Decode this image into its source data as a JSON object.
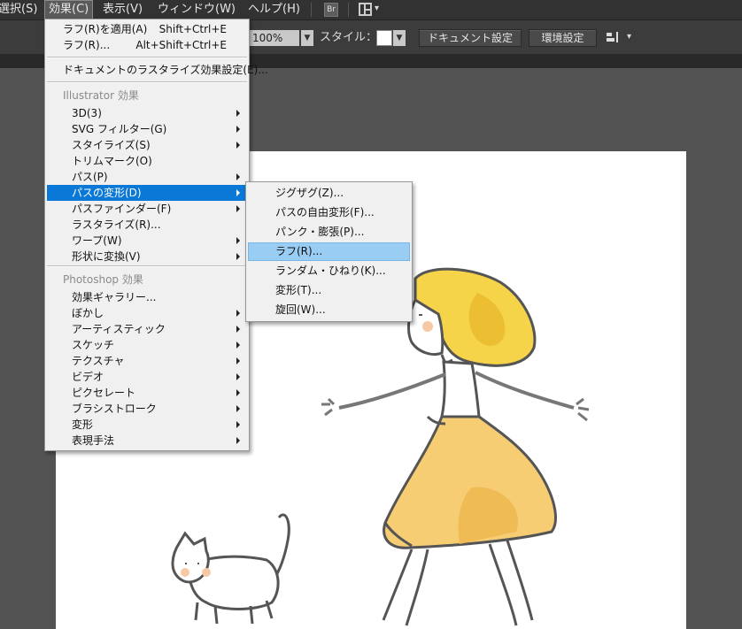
{
  "menubar": {
    "items": [
      {
        "label": "選択(S)"
      },
      {
        "label": "効果(C)"
      },
      {
        "label": "表示(V)"
      },
      {
        "label": "ウィンドウ(W)"
      },
      {
        "label": "ヘルプ(H)"
      }
    ],
    "bridge_icon_text": "Br"
  },
  "controlbar": {
    "opacity_value": "100%",
    "style_label": "スタイル：",
    "doc_settings_label": "ドキュメント設定",
    "prefs_label": "環境設定"
  },
  "effect_menu": {
    "apply_last": {
      "label": "ラフ(R)を適用(A)",
      "shortcut": "Shift+Ctrl+E"
    },
    "last_effect": {
      "label": "ラフ(R)...",
      "shortcut": "Alt+Shift+Ctrl+E"
    },
    "raster_settings": {
      "label": "ドキュメントのラスタライズ効果設定(E)..."
    },
    "illustrator_header": "Illustrator 効果",
    "illustrator_items": [
      {
        "label": "3D(3)",
        "submenu": true
      },
      {
        "label": "SVG フィルター(G)",
        "submenu": true
      },
      {
        "label": "スタイライズ(S)",
        "submenu": true
      },
      {
        "label": "トリムマーク(O)",
        "submenu": false
      },
      {
        "label": "パス(P)",
        "submenu": true
      },
      {
        "label": "パスの変形(D)",
        "submenu": true
      },
      {
        "label": "パスファインダー(F)",
        "submenu": true
      },
      {
        "label": "ラスタライズ(R)...",
        "submenu": false
      },
      {
        "label": "ワープ(W)",
        "submenu": true
      },
      {
        "label": "形状に変換(V)",
        "submenu": true
      }
    ],
    "photoshop_header": "Photoshop 効果",
    "photoshop_items": [
      {
        "label": "効果ギャラリー...",
        "submenu": false
      },
      {
        "label": "ぼかし",
        "submenu": true
      },
      {
        "label": "アーティスティック",
        "submenu": true
      },
      {
        "label": "スケッチ",
        "submenu": true
      },
      {
        "label": "テクスチャ",
        "submenu": true
      },
      {
        "label": "ビデオ",
        "submenu": true
      },
      {
        "label": "ピクセレート",
        "submenu": true
      },
      {
        "label": "ブラシストローク",
        "submenu": true
      },
      {
        "label": "変形",
        "submenu": true
      },
      {
        "label": "表現手法",
        "submenu": true
      }
    ],
    "highlighted_item": "パスの変形(D)",
    "highlight_color": "#0a78d7"
  },
  "distort_submenu": {
    "items": [
      {
        "label": "ジグザグ(Z)..."
      },
      {
        "label": "パスの自由変形(F)..."
      },
      {
        "label": "パンク・膨張(P)..."
      },
      {
        "label": "ラフ(R)..."
      },
      {
        "label": "ランダム・ひねり(K)..."
      },
      {
        "label": "変形(T)..."
      },
      {
        "label": "旋回(W)..."
      }
    ],
    "hovered_item": "ラフ(R)...",
    "hover_color": "#99cdf4"
  },
  "colors": {
    "pasteboard": "#535353",
    "artboard": "#ffffff",
    "hair": "#f6d44a",
    "skirt": "#f7cd74",
    "line": "#555555"
  }
}
